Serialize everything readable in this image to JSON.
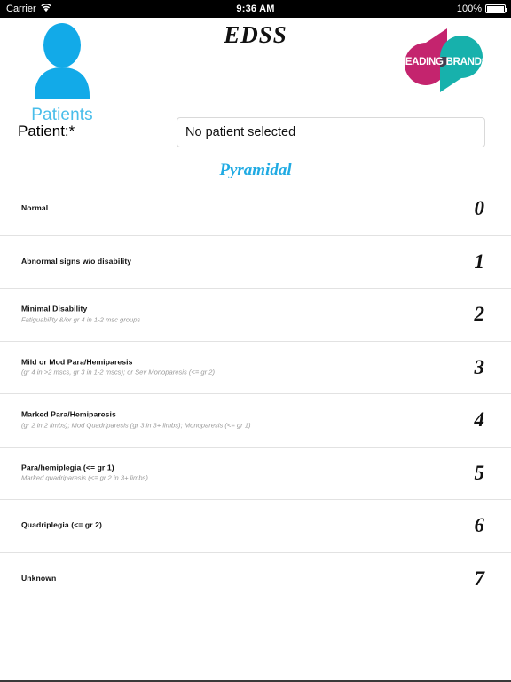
{
  "status_bar": {
    "carrier": "Carrier",
    "wifi_icon": "wifi-icon",
    "time": "9:36 AM",
    "battery_percent": "100%",
    "battery_icon": "battery-icon"
  },
  "header": {
    "patients_button": {
      "icon": "person-icon",
      "label": "Patients"
    },
    "title": "EDSS",
    "logo": {
      "text": "LEADING BRANDS",
      "magenta": "#C4246E",
      "teal": "#17B1AC",
      "overlap": "#4A2A40"
    }
  },
  "patient": {
    "label": "Patient:*",
    "value": "No patient selected",
    "placeholder": "No patient selected"
  },
  "section": {
    "title": "Pyramidal",
    "accent_color": "#21ABE3"
  },
  "scale": {
    "rows": [
      {
        "title": "Normal",
        "sub": "",
        "score": "0"
      },
      {
        "title": "Abnormal signs w/o disability",
        "sub": "",
        "score": "1"
      },
      {
        "title": "Minimal Disability",
        "sub": "Fatiguability &/or gr 4 in 1-2 msc groups",
        "score": "2"
      },
      {
        "title": "Mild or Mod Para/Hemiparesis",
        "sub": "(gr 4 in >2 mscs, gr 3 in 1-2 mscs); or Sev Monoparesis (<= gr 2)",
        "score": "3"
      },
      {
        "title": "Marked Para/Hemiparesis",
        "sub": "(gr 2 in 2 limbs); Mod Quadriparesis (gr 3 in 3+ limbs); Monoparesis (<= gr 1)",
        "score": "4"
      },
      {
        "title": "Para/hemiplegia (<= gr 1)",
        "sub": "Marked quadriparesis (<= gr 2 in 3+ limbs)",
        "score": "5"
      },
      {
        "title": "Quadriplegia (<= gr 2)",
        "sub": "",
        "score": "6"
      },
      {
        "title": "Unknown",
        "sub": "",
        "score": "7"
      }
    ]
  }
}
